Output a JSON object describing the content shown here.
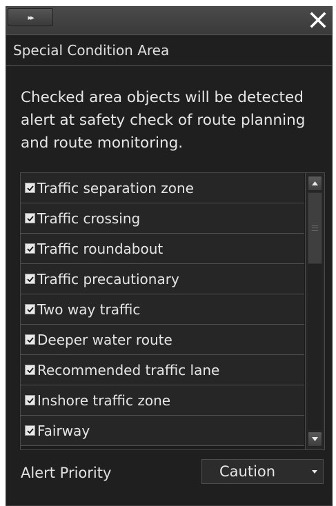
{
  "titlebar": {
    "collapse_label": "▸▸",
    "collapse_icon": "double-chevron-right-icon",
    "close_icon": "close-icon"
  },
  "header": {
    "title": "Special Condition Area"
  },
  "description": "Checked area objects will be detected alert at safety check of route planning and route monitoring.",
  "area_list": {
    "items": [
      {
        "label": "Traffic separation zone",
        "checked": true
      },
      {
        "label": "Traffic crossing",
        "checked": true
      },
      {
        "label": "Traffic roundabout",
        "checked": true
      },
      {
        "label": "Traffic precautionary",
        "checked": true
      },
      {
        "label": "Two way traffic",
        "checked": true
      },
      {
        "label": "Deeper water route",
        "checked": true
      },
      {
        "label": "Recommended traffic lane",
        "checked": true
      },
      {
        "label": "Inshore traffic zone",
        "checked": true
      },
      {
        "label": "Fairway",
        "checked": true
      }
    ],
    "scroll_position": 0.0
  },
  "alert_priority": {
    "label": "Alert Priority",
    "value": "Caution"
  },
  "colors": {
    "panel_bg": "#1f1f1f",
    "row_bg": "#262626",
    "text": "#e6e6e6"
  }
}
